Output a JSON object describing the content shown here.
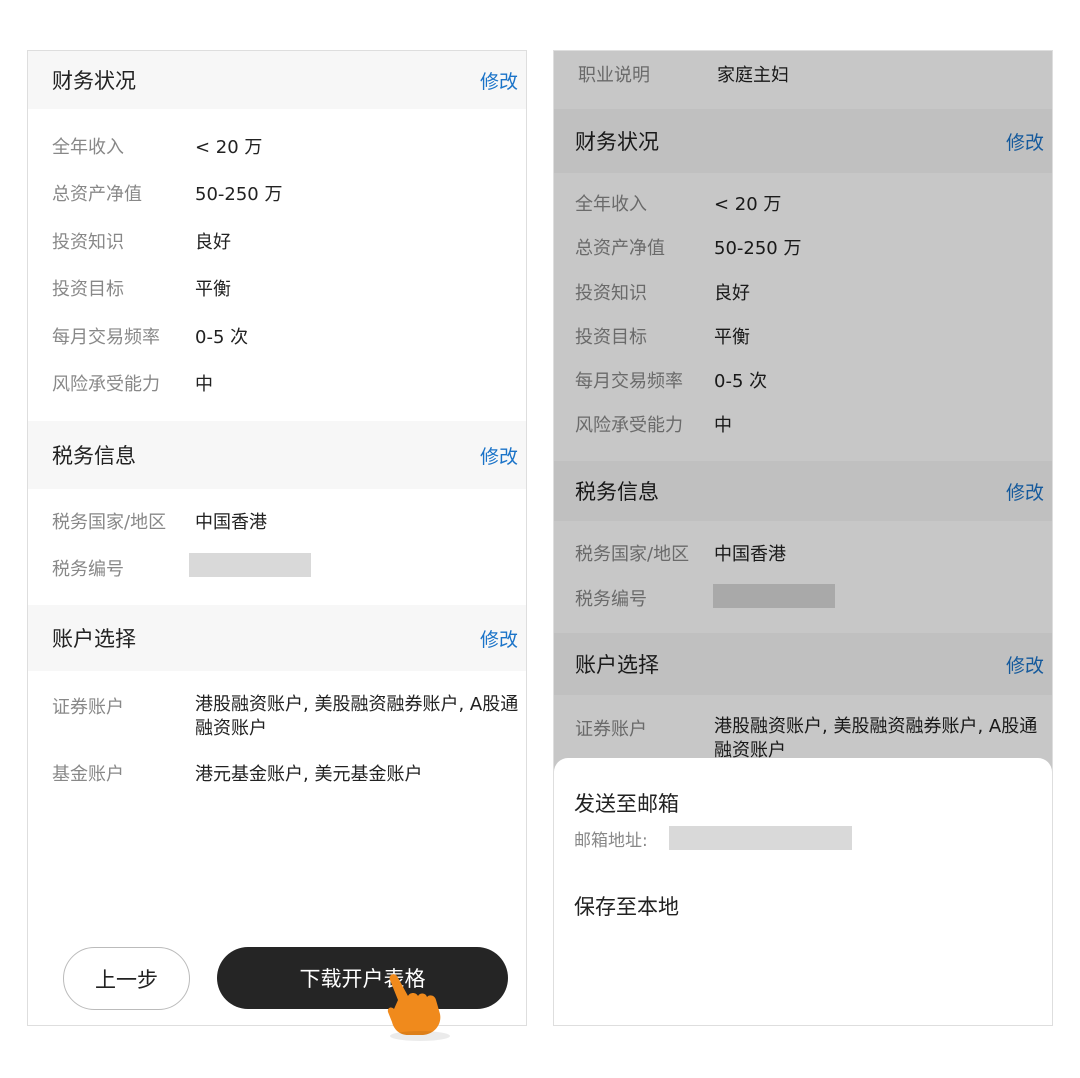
{
  "left": {
    "finance": {
      "title": "财务状况",
      "edit": "修改",
      "rows": [
        {
          "label": "全年收入",
          "value": "< 20 万"
        },
        {
          "label": "总资产净值",
          "value": "50-250 万"
        },
        {
          "label": "投资知识",
          "value": "良好"
        },
        {
          "label": "投资目标",
          "value": "平衡"
        },
        {
          "label": "每月交易频率",
          "value": "0-5 次"
        },
        {
          "label": "风险承受能力",
          "value": "中"
        }
      ]
    },
    "tax": {
      "title": "税务信息",
      "edit": "修改",
      "rows": [
        {
          "label": "税务国家/地区",
          "value": "中国香港"
        },
        {
          "label": "税务编号",
          "value": ""
        }
      ]
    },
    "account": {
      "title": "账户选择",
      "edit": "修改",
      "rows": [
        {
          "label": "证券账户",
          "value": "港股融资账户, 美股融资融券账户, A股通融资账户"
        },
        {
          "label": "基金账户",
          "value": "港元基金账户, 美元基金账户"
        }
      ]
    },
    "buttons": {
      "prev": "上一步",
      "download": "下载开户表格"
    }
  },
  "right": {
    "occupation": {
      "label": "职业说明",
      "value": "家庭主妇"
    },
    "finance": {
      "title": "财务状况",
      "edit": "修改",
      "rows": [
        {
          "label": "全年收入",
          "value": "< 20 万"
        },
        {
          "label": "总资产净值",
          "value": "50-250 万"
        },
        {
          "label": "投资知识",
          "value": "良好"
        },
        {
          "label": "投资目标",
          "value": "平衡"
        },
        {
          "label": "每月交易频率",
          "value": "0-5 次"
        },
        {
          "label": "风险承受能力",
          "value": "中"
        }
      ]
    },
    "tax": {
      "title": "税务信息",
      "edit": "修改",
      "rows": [
        {
          "label": "税务国家/地区",
          "value": "中国香港"
        },
        {
          "label": "税务编号",
          "value": ""
        }
      ]
    },
    "account": {
      "title": "账户选择",
      "edit": "修改",
      "rows": [
        {
          "label": "证券账户",
          "value": "港股融资账户, 美股融资融券账户, A股通融资账户"
        }
      ]
    },
    "sheet": {
      "send_email": "发送至邮箱",
      "email_label": "邮箱地址:",
      "save_local": "保存至本地"
    }
  },
  "colors": {
    "accent": "#1a73c8",
    "primary_button": "#252525",
    "hand": "#f08a1c"
  }
}
